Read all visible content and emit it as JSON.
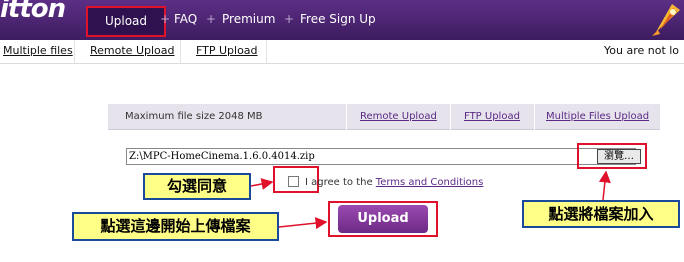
{
  "topbar": {
    "logo_text": "itton",
    "nav": {
      "upload": "Upload",
      "faq": "FAQ",
      "premium": "Premium",
      "signup": "Free Sign Up",
      "separator": "+"
    }
  },
  "subnav": {
    "multiple_files": "Multiple files",
    "remote_upload": "Remote Upload",
    "ftp_upload": "FTP Upload",
    "login_status": "You are not lo"
  },
  "uploader": {
    "max_size": "Maximum file size 2048 MB",
    "links": {
      "remote_upload": "Remote Upload",
      "ftp_upload": "FTP Upload",
      "multiple_files_upload": "Multiple Files Upload"
    },
    "file_path": "Z:\\MPC-HomeCinema.1.6.0.4014.zip",
    "browse_label": "瀏覽…",
    "agree_text": "I agree to the",
    "terms_link": "Terms and Conditions",
    "upload_button": "Upload"
  },
  "annotations": {
    "check_agree": "勾選同意",
    "click_upload": "點選這邊開始上傳檔案",
    "click_add_file": "點選將檔案加入"
  },
  "colors": {
    "nav_purple": "#4b2470",
    "highlight_red": "#e0112b",
    "callout_yellow": "#ffff88",
    "callout_border": "#1a4b9b",
    "button_purple": "#7b3394"
  }
}
